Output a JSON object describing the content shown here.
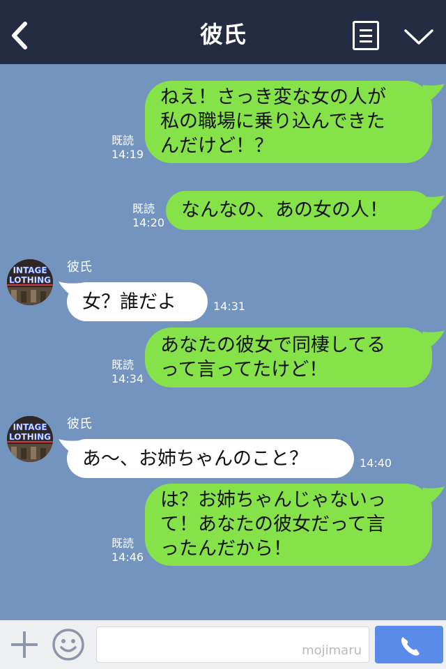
{
  "header": {
    "title": "彼氏",
    "back_icon": "chevron-left-icon",
    "menu_icon": "notes-icon",
    "more_icon": "chevron-down-icon",
    "background": "#232c42"
  },
  "chat": {
    "background": "#7494c0",
    "messages": [
      {
        "side": "right",
        "lines": [
          "ねえ！さっき変な女の人が",
          "私の職場に乗り込んできた",
          "んだけど！？"
        ],
        "read": "既読",
        "time": "14:19"
      },
      {
        "side": "right",
        "lines": [
          "なんなの、あの女の人！"
        ],
        "read": "既読",
        "time": "14:20"
      },
      {
        "side": "left",
        "sender": "彼氏",
        "lines": [
          "女？誰だよ"
        ],
        "time": "14:31",
        "avatar_text": [
          "INTAGE",
          "LOTHING"
        ]
      },
      {
        "side": "right",
        "lines": [
          "あなたの彼女で同棲してる",
          "って言ってたけど！"
        ],
        "read": "既読",
        "time": "14:34"
      },
      {
        "side": "left",
        "sender": "彼氏",
        "lines": [
          "あ〜、お姉ちゃんのこと？"
        ],
        "time": "14:40",
        "avatar_text": [
          "INTAGE",
          "LOTHING"
        ]
      },
      {
        "side": "right",
        "lines": [
          "は？お姉ちゃんじゃないっ",
          "て！あなたの彼女だって言",
          "ったんだから！"
        ],
        "read": "既読",
        "time": "14:46"
      }
    ],
    "bubble_colors": {
      "mine": "#85e249",
      "theirs": "#ffffff"
    }
  },
  "footer": {
    "plus_icon": "plus-icon",
    "emoji_icon": "smiley-icon",
    "input_value": "",
    "watermark": "mojimaru",
    "call_icon": "phone-icon",
    "call_color": "#5a8be8"
  }
}
